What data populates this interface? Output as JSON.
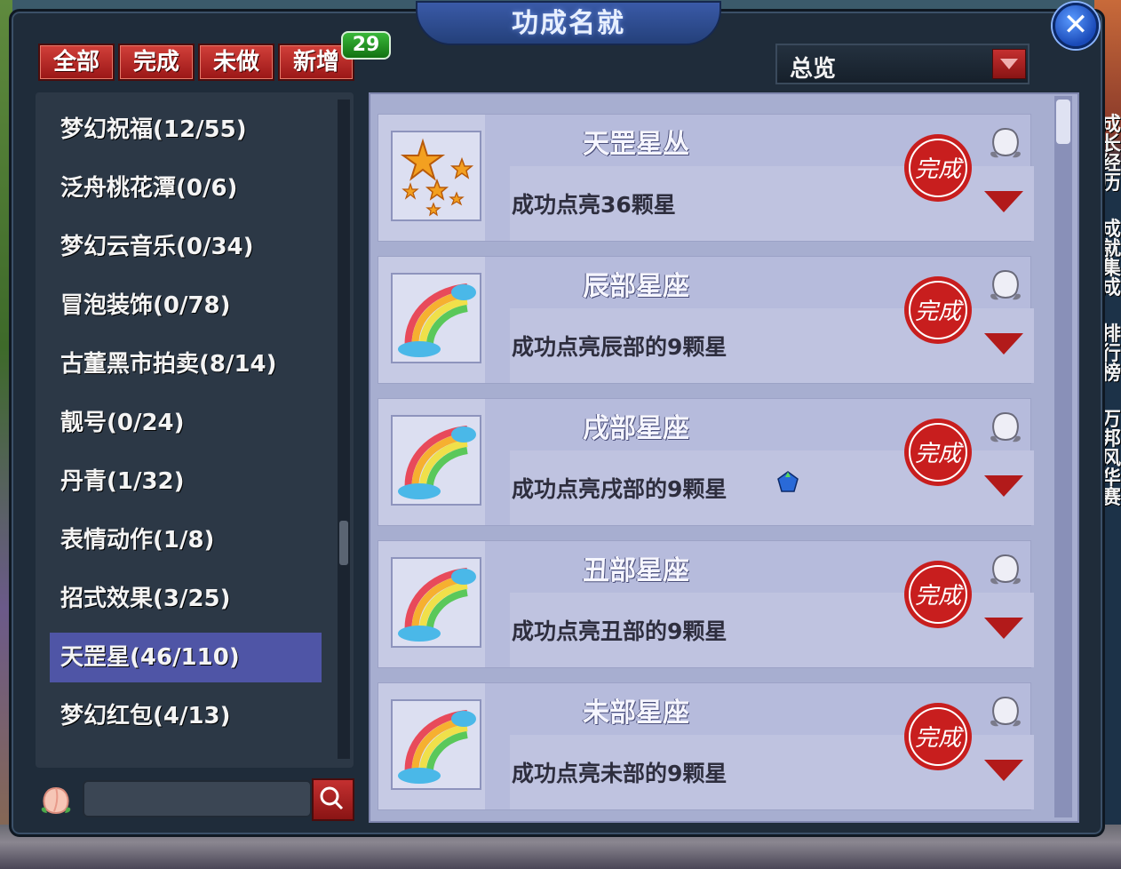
{
  "window": {
    "title": "功成名就"
  },
  "filter_tabs": [
    {
      "label": "全部"
    },
    {
      "label": "完成"
    },
    {
      "label": "未做"
    },
    {
      "label": "新增"
    }
  ],
  "new_badge": "29",
  "overview": {
    "label": "总览"
  },
  "categories": [
    {
      "label": "梦幻祝福(12/55)"
    },
    {
      "label": "泛舟桃花潭(0/6)"
    },
    {
      "label": "梦幻云音乐(0/34)"
    },
    {
      "label": "冒泡装饰(0/78)"
    },
    {
      "label": "古董黑市拍卖(8/14)"
    },
    {
      "label": "靓号(0/24)"
    },
    {
      "label": "丹青(1/32)"
    },
    {
      "label": "表情动作(1/8)"
    },
    {
      "label": "招式效果(3/25)"
    },
    {
      "label": "天罡星(46/110)",
      "selected": true
    },
    {
      "label": "梦幻红包(4/13)"
    }
  ],
  "search": {
    "value": ""
  },
  "achievements": [
    {
      "title": "天罡星丛",
      "description": "成功点亮36颗星",
      "icon": "stars-icon",
      "status": "completed"
    },
    {
      "title": "辰部星座",
      "description": "成功点亮辰部的9颗星",
      "icon": "rainbow-icon",
      "status": "completed"
    },
    {
      "title": "戌部星座",
      "description": "成功点亮戌部的9颗星",
      "icon": "rainbow-icon",
      "status": "completed"
    },
    {
      "title": "丑部星座",
      "description": "成功点亮丑部的9颗星",
      "icon": "rainbow-icon",
      "status": "completed"
    },
    {
      "title": "未部星座",
      "description": "成功点亮未部的9颗星",
      "icon": "rainbow-icon",
      "status": "completed"
    }
  ],
  "completed_stamp_text": "完成",
  "side_tabs": [
    {
      "label": "成长经历"
    },
    {
      "label": "成就集成"
    },
    {
      "label": "排行榜"
    },
    {
      "label": "万邦风华赛"
    }
  ],
  "colors": {
    "accent_red": "#b21a1a",
    "selected_row": "#4f55a6",
    "panel": "#a7aed0"
  }
}
